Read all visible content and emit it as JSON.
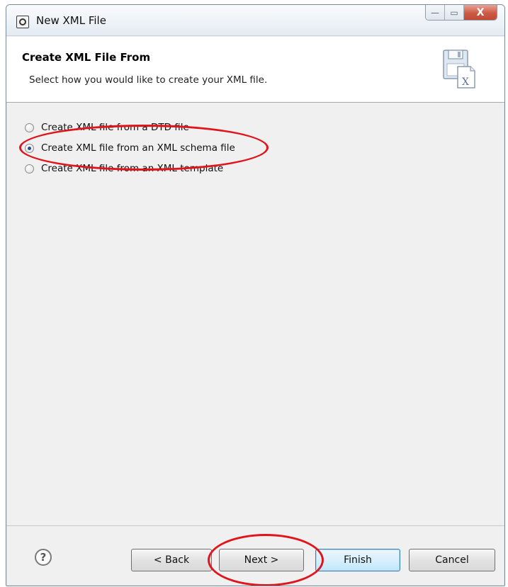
{
  "window": {
    "title": "New XML File",
    "minimize_glyph": "—",
    "maximize_glyph": "▭",
    "close_glyph": "X"
  },
  "header": {
    "title": "Create XML File From",
    "description": "Select how you would like to create your XML file.",
    "icon": "new-xml-file-wizard-icon"
  },
  "options": [
    {
      "label": "Create XML file from a DTD file",
      "selected": false
    },
    {
      "label": "Create XML file from an XML schema file",
      "selected": true
    },
    {
      "label": "Create XML file from an XML template",
      "selected": false
    }
  ],
  "buttons": {
    "help_glyph": "?",
    "back": "< Back",
    "next": "Next >",
    "finish": "Finish",
    "cancel": "Cancel"
  },
  "colors": {
    "annotation": "#e0141b",
    "default_button_border": "#3c7fb1"
  }
}
